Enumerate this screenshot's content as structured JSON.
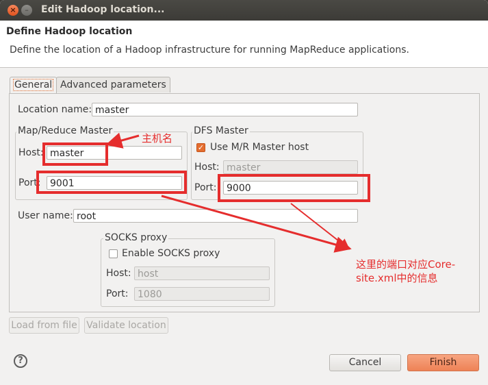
{
  "window": {
    "title": "Edit Hadoop location..."
  },
  "header": {
    "title": "Define Hadoop location",
    "description": "Define the location of a Hadoop infrastructure for running MapReduce applications."
  },
  "tabs": [
    {
      "label": "General",
      "active": true
    },
    {
      "label": "Advanced parameters",
      "active": false
    }
  ],
  "form": {
    "location_name_label": "Location name:",
    "location_name_value": "master",
    "mr_master": {
      "title": "Map/Reduce Master",
      "host_label": "Host:",
      "host_value": "master",
      "port_label": "Port:",
      "port_value": "9001"
    },
    "dfs_master": {
      "title": "DFS Master",
      "use_mr_label": "Use M/R Master host",
      "use_mr_checked": true,
      "host_label": "Host:",
      "host_value": "master",
      "port_label": "Port:",
      "port_value": "9000"
    },
    "user_name_label": "User name:",
    "user_name_value": "root",
    "socks": {
      "title": "SOCKS proxy",
      "enable_label": "Enable SOCKS proxy",
      "enable_checked": false,
      "host_label": "Host:",
      "host_value": "host",
      "port_label": "Port:",
      "port_value": "1080"
    }
  },
  "buttons": {
    "load_from_file": "Load from file",
    "validate_location": "Validate location",
    "cancel": "Cancel",
    "finish": "Finish"
  },
  "annotations": {
    "hostname_note": "主机名",
    "port_note_line1": "这里的端口对应Core-",
    "port_note_line2": "site.xml中的信息",
    "color": "#e52d2d"
  },
  "icons": {
    "close": "close-icon",
    "minimize": "minimize-icon",
    "help": "help-icon",
    "check": "checkmark-icon"
  }
}
